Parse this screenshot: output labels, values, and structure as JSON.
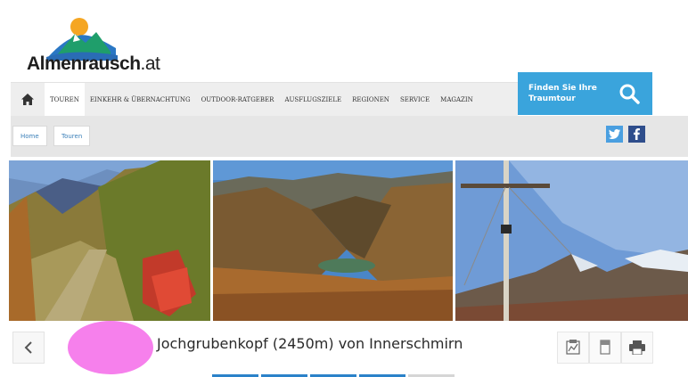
{
  "brand": {
    "name": "Almenrausch",
    "tld": ".at"
  },
  "search_cta": {
    "text": "Finden Sie Ihre\nTraumtour",
    "icon": "search-icon"
  },
  "nav": {
    "home_icon": "home-icon",
    "items": [
      {
        "label": "TOUREN",
        "active": true
      },
      {
        "label": "EINKEHR & ÜBERNACHTUNG"
      },
      {
        "label": "OUTDOOR-RATGEBER"
      },
      {
        "label": "AUSFLUGSZIELE"
      },
      {
        "label": "REGIONEN"
      },
      {
        "label": "SERVICE"
      },
      {
        "label": "MAGAZIN"
      }
    ]
  },
  "breadcrumb": [
    {
      "label": "Home"
    },
    {
      "label": "Touren"
    }
  ],
  "social": {
    "twitter": "twitter-icon",
    "facebook": "facebook-icon"
  },
  "gallery": [
    {
      "subject": "autumn mountain path with red shrubs"
    },
    {
      "subject": "valley with lake and autumn slopes"
    },
    {
      "subject": "summit cross with mountain view"
    }
  ],
  "tour": {
    "title": "Jochgrubenkopf (2450m) von Innerschmirn"
  },
  "toolbar": {
    "map": "map-icon",
    "bookmark": "bookmark-icon",
    "print": "print-icon"
  },
  "colors": {
    "accent": "#3aa4dc",
    "tab_active": "#2b82c9",
    "redaction": "#f680ec"
  }
}
